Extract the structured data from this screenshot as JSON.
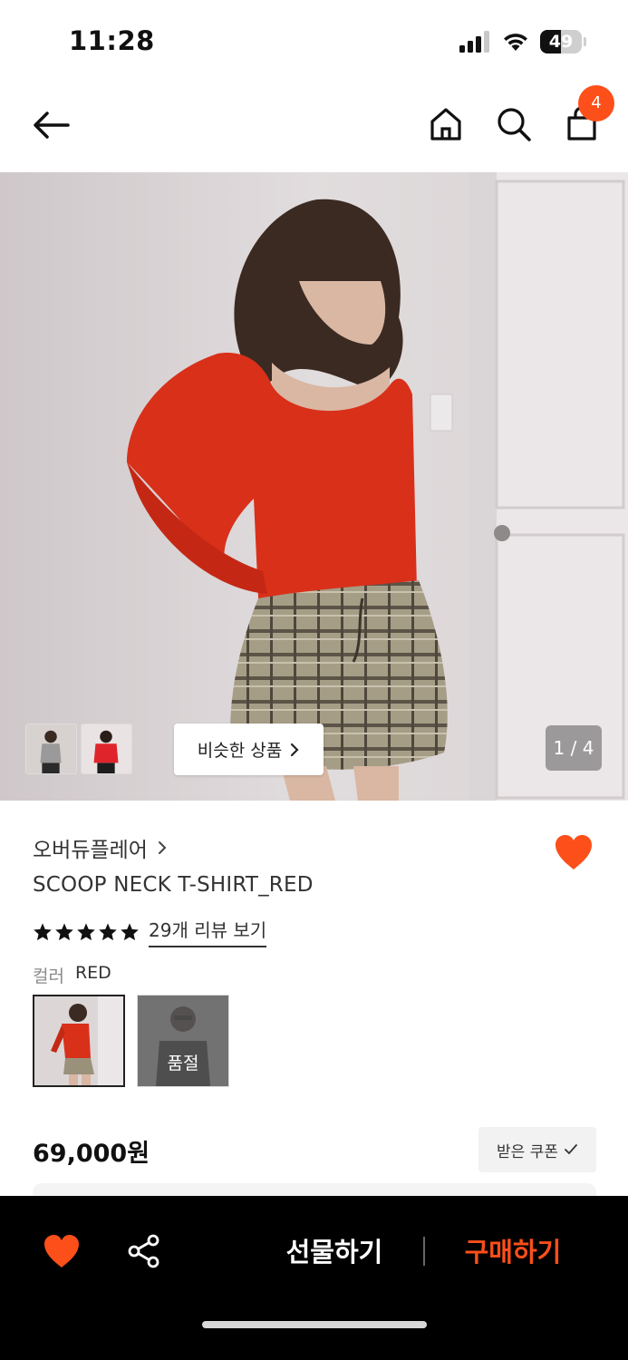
{
  "status_bar": {
    "time": "11:28",
    "battery_level": "49",
    "battery_fraction": 0.49,
    "icons": [
      "signal-icon",
      "wifi-icon",
      "battery-icon"
    ]
  },
  "nav": {
    "icons": [
      "back-arrow-icon",
      "home-icon",
      "search-icon",
      "shopping-bag-icon"
    ],
    "cart_count": "4"
  },
  "hero": {
    "similar_products_label": "비슷한 상품",
    "page_indicator": "1 / 4",
    "current_page": 1,
    "total_pages": 4
  },
  "product": {
    "brand": "오버듀플레어",
    "name": "SCOOP NECK T-SHIRT_RED",
    "rating_stars": 5,
    "review_link": "29개 리뷰 보기",
    "favorited": true,
    "color_label": "컬러",
    "color_value": "RED",
    "swatches": [
      {
        "color": "RED",
        "selected": true,
        "sold_out": false
      },
      {
        "color": "BLACK",
        "selected": false,
        "sold_out": true,
        "status_label": "품절"
      }
    ],
    "price": "69,000원",
    "coupon_label": "받은 쿠폰"
  },
  "bottom_bar": {
    "gift_label": "선물하기",
    "buy_label": "구매하기",
    "icons": [
      "heart-icon",
      "share-icon"
    ]
  },
  "colors": {
    "accent": "#fc4f1a",
    "text": "#222222",
    "bottom_bar_bg": "#000000"
  }
}
